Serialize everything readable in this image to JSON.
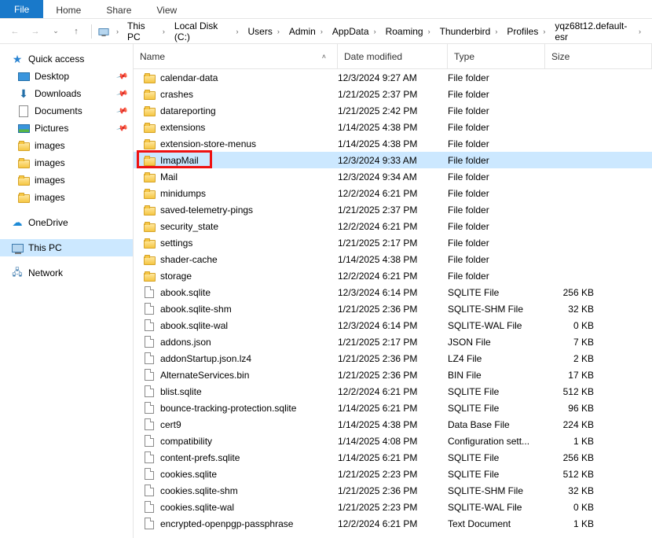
{
  "ribbon": {
    "file": "File",
    "home": "Home",
    "share": "Share",
    "view": "View"
  },
  "breadcrumb": [
    "This PC",
    "Local Disk (C:)",
    "Users",
    "Admin",
    "AppData",
    "Roaming",
    "Thunderbird",
    "Profiles",
    "yqz68t12.default-esr"
  ],
  "columns": {
    "name": "Name",
    "date": "Date modified",
    "type": "Type",
    "size": "Size"
  },
  "navpane": {
    "quick": "Quick access",
    "items": [
      {
        "label": "Desktop",
        "icon": "desktop",
        "pin": true
      },
      {
        "label": "Downloads",
        "icon": "downloads",
        "pin": true
      },
      {
        "label": "Documents",
        "icon": "doc",
        "pin": true
      },
      {
        "label": "Pictures",
        "icon": "pic",
        "pin": true
      },
      {
        "label": "images",
        "icon": "folder",
        "pin": false
      },
      {
        "label": "images",
        "icon": "folder",
        "pin": false
      },
      {
        "label": "images",
        "icon": "folder",
        "pin": false
      },
      {
        "label": "images",
        "icon": "folder",
        "pin": false
      }
    ],
    "onedrive": "OneDrive",
    "thispc": "This PC",
    "network": "Network"
  },
  "highlighted_index": 5,
  "files": [
    {
      "name": "calendar-data",
      "date": "12/3/2024 9:27 AM",
      "type": "File folder",
      "size": "",
      "icon": "folder"
    },
    {
      "name": "crashes",
      "date": "1/21/2025 2:37 PM",
      "type": "File folder",
      "size": "",
      "icon": "folder"
    },
    {
      "name": "datareporting",
      "date": "1/21/2025 2:42 PM",
      "type": "File folder",
      "size": "",
      "icon": "folder"
    },
    {
      "name": "extensions",
      "date": "1/14/2025 4:38 PM",
      "type": "File folder",
      "size": "",
      "icon": "folder"
    },
    {
      "name": "extension-store-menus",
      "date": "1/14/2025 4:38 PM",
      "type": "File folder",
      "size": "",
      "icon": "folder"
    },
    {
      "name": "ImapMail",
      "date": "12/3/2024 9:33 AM",
      "type": "File folder",
      "size": "",
      "icon": "folder",
      "sel": true
    },
    {
      "name": "Mail",
      "date": "12/3/2024 9:34 AM",
      "type": "File folder",
      "size": "",
      "icon": "folder"
    },
    {
      "name": "minidumps",
      "date": "12/2/2024 6:21 PM",
      "type": "File folder",
      "size": "",
      "icon": "folder"
    },
    {
      "name": "saved-telemetry-pings",
      "date": "1/21/2025 2:37 PM",
      "type": "File folder",
      "size": "",
      "icon": "folder"
    },
    {
      "name": "security_state",
      "date": "12/2/2024 6:21 PM",
      "type": "File folder",
      "size": "",
      "icon": "folder"
    },
    {
      "name": "settings",
      "date": "1/21/2025 2:17 PM",
      "type": "File folder",
      "size": "",
      "icon": "folder"
    },
    {
      "name": "shader-cache",
      "date": "1/14/2025 4:38 PM",
      "type": "File folder",
      "size": "",
      "icon": "folder"
    },
    {
      "name": "storage",
      "date": "12/2/2024 6:21 PM",
      "type": "File folder",
      "size": "",
      "icon": "folder"
    },
    {
      "name": "abook.sqlite",
      "date": "12/3/2024 6:14 PM",
      "type": "SQLITE File",
      "size": "256 KB",
      "icon": "file"
    },
    {
      "name": "abook.sqlite-shm",
      "date": "1/21/2025 2:36 PM",
      "type": "SQLITE-SHM File",
      "size": "32 KB",
      "icon": "file"
    },
    {
      "name": "abook.sqlite-wal",
      "date": "12/3/2024 6:14 PM",
      "type": "SQLITE-WAL File",
      "size": "0 KB",
      "icon": "file"
    },
    {
      "name": "addons.json",
      "date": "1/21/2025 2:17 PM",
      "type": "JSON File",
      "size": "7 KB",
      "icon": "file"
    },
    {
      "name": "addonStartup.json.lz4",
      "date": "1/21/2025 2:36 PM",
      "type": "LZ4 File",
      "size": "2 KB",
      "icon": "file"
    },
    {
      "name": "AlternateServices.bin",
      "date": "1/21/2025 2:36 PM",
      "type": "BIN File",
      "size": "17 KB",
      "icon": "file"
    },
    {
      "name": "blist.sqlite",
      "date": "12/2/2024 6:21 PM",
      "type": "SQLITE File",
      "size": "512 KB",
      "icon": "file"
    },
    {
      "name": "bounce-tracking-protection.sqlite",
      "date": "1/14/2025 6:21 PM",
      "type": "SQLITE File",
      "size": "96 KB",
      "icon": "file"
    },
    {
      "name": "cert9",
      "date": "1/14/2025 4:38 PM",
      "type": "Data Base File",
      "size": "224 KB",
      "icon": "file"
    },
    {
      "name": "compatibility",
      "date": "1/14/2025 4:08 PM",
      "type": "Configuration sett...",
      "size": "1 KB",
      "icon": "file"
    },
    {
      "name": "content-prefs.sqlite",
      "date": "1/14/2025 6:21 PM",
      "type": "SQLITE File",
      "size": "256 KB",
      "icon": "file"
    },
    {
      "name": "cookies.sqlite",
      "date": "1/21/2025 2:23 PM",
      "type": "SQLITE File",
      "size": "512 KB",
      "icon": "file"
    },
    {
      "name": "cookies.sqlite-shm",
      "date": "1/21/2025 2:36 PM",
      "type": "SQLITE-SHM File",
      "size": "32 KB",
      "icon": "file"
    },
    {
      "name": "cookies.sqlite-wal",
      "date": "1/21/2025 2:23 PM",
      "type": "SQLITE-WAL File",
      "size": "0 KB",
      "icon": "file"
    },
    {
      "name": "encrypted-openpgp-passphrase",
      "date": "12/2/2024 6:21 PM",
      "type": "Text Document",
      "size": "1 KB",
      "icon": "file"
    }
  ]
}
